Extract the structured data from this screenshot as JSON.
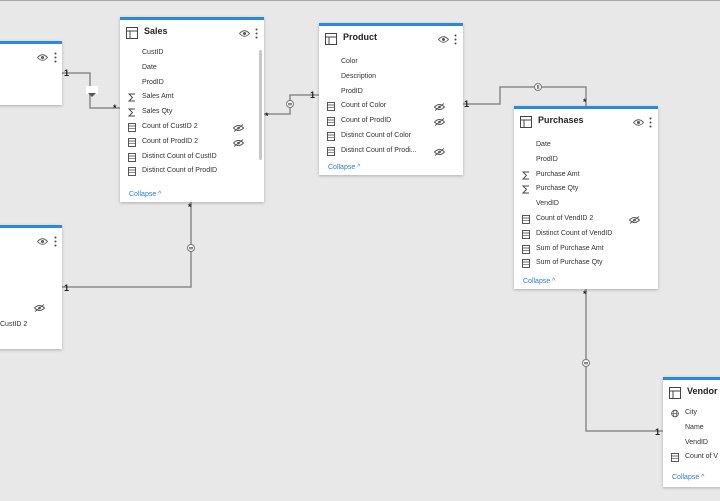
{
  "tables": {
    "left_top": {
      "name": ""
    },
    "left_bottom": {
      "name": "",
      "fields": [
        "CustID 2"
      ]
    },
    "sales": {
      "name": "Sales",
      "fields": [
        {
          "label": "CustID",
          "icon": "none",
          "hidden": false
        },
        {
          "label": "Date",
          "icon": "none",
          "hidden": false
        },
        {
          "label": "ProdID",
          "icon": "none",
          "hidden": false
        },
        {
          "label": "Sales Amt",
          "icon": "sigma",
          "hidden": false
        },
        {
          "label": "Sales Qty",
          "icon": "sigma",
          "hidden": false
        },
        {
          "label": "Count of CustID 2",
          "icon": "calc",
          "hidden": true
        },
        {
          "label": "Count of ProdID 2",
          "icon": "calc",
          "hidden": true
        },
        {
          "label": "Distinct Count of CustID",
          "icon": "calc",
          "hidden": false
        },
        {
          "label": "Distinct Count of ProdID",
          "icon": "calc",
          "hidden": false
        }
      ],
      "collapse": "Collapse ^"
    },
    "product": {
      "name": "Product",
      "fields": [
        {
          "label": "Color",
          "icon": "none",
          "hidden": false
        },
        {
          "label": "Description",
          "icon": "none",
          "hidden": false
        },
        {
          "label": "ProdID",
          "icon": "none",
          "hidden": false
        },
        {
          "label": "Count of Color",
          "icon": "calc",
          "hidden": true
        },
        {
          "label": "Count of ProdID",
          "icon": "calc",
          "hidden": true
        },
        {
          "label": "Distinct Count of Color",
          "icon": "calc",
          "hidden": false
        },
        {
          "label": "Distinct Count of Prodi...",
          "icon": "calc",
          "hidden": true
        }
      ],
      "collapse": "Collapse ^"
    },
    "purchases": {
      "name": "Purchases",
      "fields": [
        {
          "label": "Date",
          "icon": "none",
          "hidden": false
        },
        {
          "label": "ProdID",
          "icon": "none",
          "hidden": false
        },
        {
          "label": "Purchase Amt",
          "icon": "sigma",
          "hidden": false
        },
        {
          "label": "Purchase Qty",
          "icon": "sigma",
          "hidden": false
        },
        {
          "label": "VendID",
          "icon": "none",
          "hidden": false
        },
        {
          "label": "Count of VendID 2",
          "icon": "calc",
          "hidden": true
        },
        {
          "label": "Distinct Count of VendID",
          "icon": "calc",
          "hidden": false
        },
        {
          "label": "Sum of Purchase Amt",
          "icon": "calc",
          "hidden": false
        },
        {
          "label": "Sum of Purchase Qty",
          "icon": "calc",
          "hidden": false
        }
      ],
      "collapse": "Collapse ^"
    },
    "vendor": {
      "name": "Vendor",
      "fields": [
        {
          "label": "City",
          "icon": "globe",
          "hidden": false
        },
        {
          "label": "Name",
          "icon": "none",
          "hidden": false
        },
        {
          "label": "VendID",
          "icon": "none",
          "hidden": false
        },
        {
          "label": "Count of V",
          "icon": "calc",
          "hidden": false
        }
      ],
      "collapse": "Collapse ^"
    }
  },
  "relationships": {
    "one": "1",
    "many": "*"
  },
  "colors": {
    "accent": "#2a8ad6",
    "link": "#2b7cd3",
    "canvas": "#e8e8e8",
    "line": "#8a8a8a"
  }
}
